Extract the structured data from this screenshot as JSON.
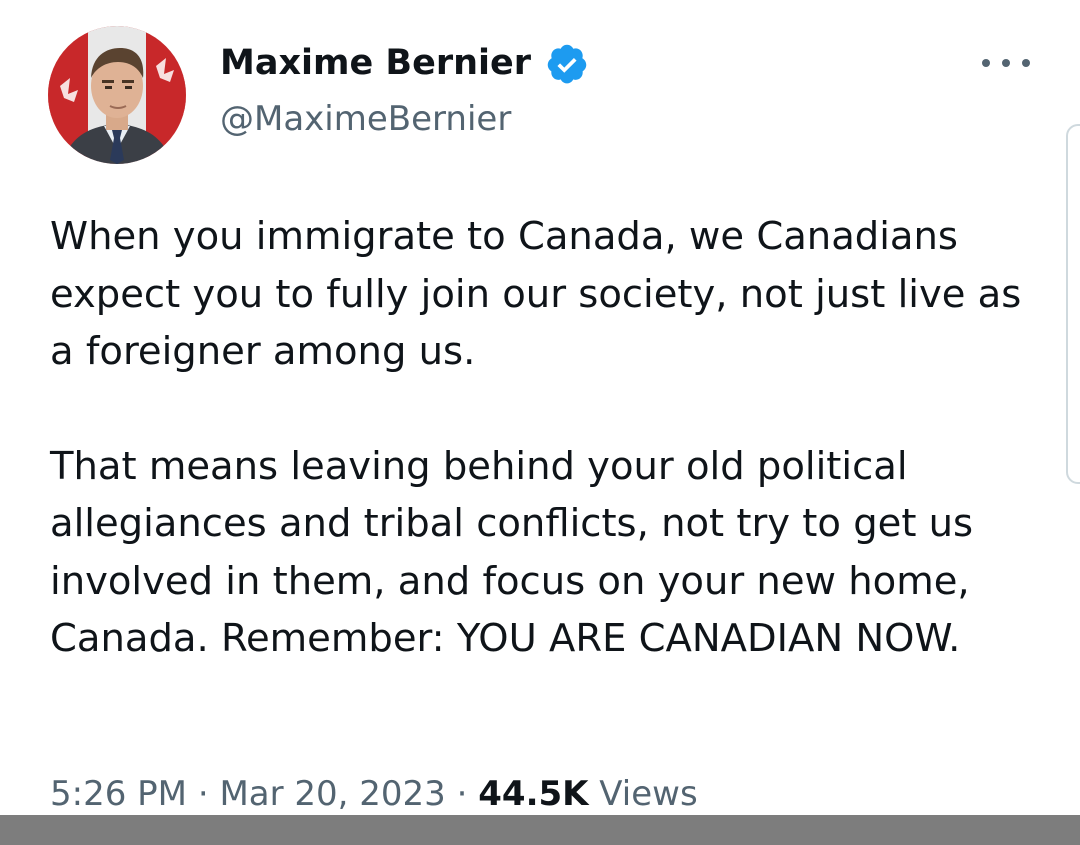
{
  "author": {
    "name": "Maxime Bernier",
    "handle": "@MaximeBernier",
    "verified_color": "#1d9bf0"
  },
  "tweet": {
    "paragraph_1": "When you immigrate to Canada, we Canadians expect you to fully join our society, not just live as a foreigner among us.",
    "paragraph_2": "That means leaving behind your old political allegiances and tribal conflicts, not try to get us involved in them, and focus on your new home, Canada. Remember: YOU ARE CANADIAN NOW."
  },
  "meta": {
    "time": "5:26 PM",
    "separator": "·",
    "date": "Mar 20, 2023",
    "views_count": "44.5K",
    "views_label": "Views"
  },
  "icons": {
    "more": "more-horizontal-icon",
    "verified": "verified-badge-icon"
  },
  "colors": {
    "text_primary": "#0f1419",
    "text_secondary": "#536471",
    "accent": "#1d9bf0"
  }
}
